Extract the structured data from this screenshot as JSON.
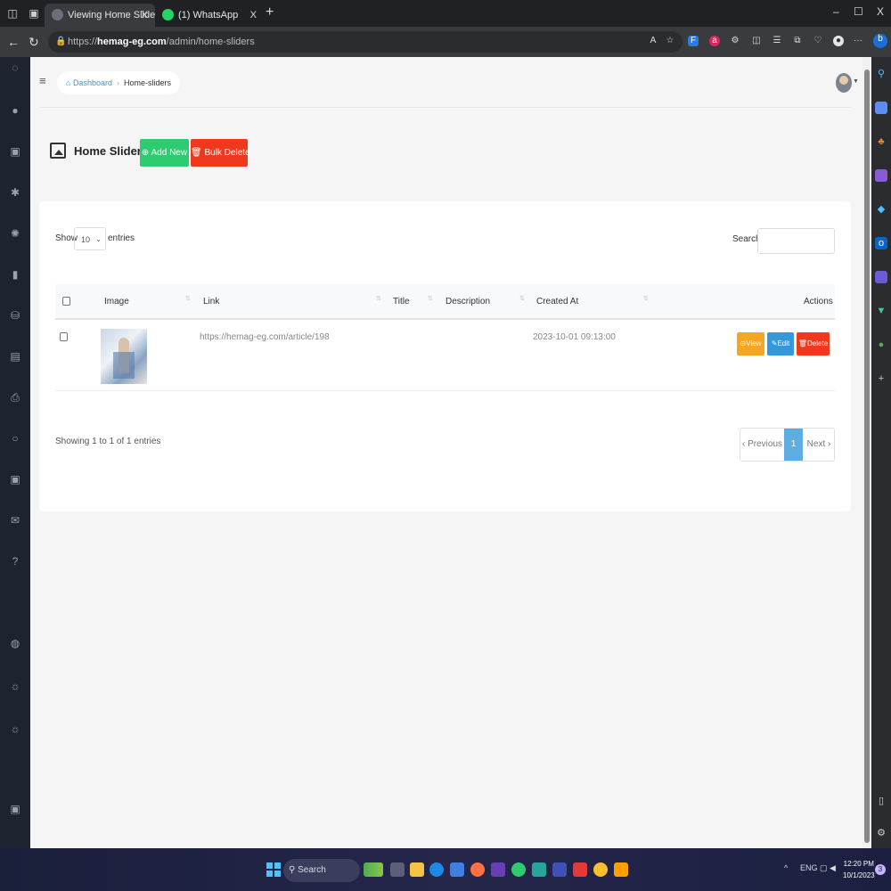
{
  "browser": {
    "tabs": [
      {
        "label": "Viewing Home Sliders",
        "close": "X"
      },
      {
        "label": "(1) WhatsApp",
        "close": "X"
      }
    ],
    "new_tab": "+",
    "window": {
      "minimize": "–",
      "restore": "☐",
      "close": "X"
    },
    "url_prefix": "https://",
    "url_host": "hemag-eg.com",
    "url_path": "/admin/home-sliders",
    "more": "···",
    "whatsapp_color": "#25d366"
  },
  "nav": {
    "breadcrumb": {
      "home": "Dashboard",
      "current": "Home-sliders"
    }
  },
  "page": {
    "title": "Home Sliders",
    "add_new": "Add New",
    "bulk_delete": "Bulk Delete"
  },
  "table": {
    "show_label": "Show",
    "length_value": "10",
    "entries_label": "entries",
    "search_label": "Search:",
    "columns": {
      "image": "Image",
      "link": "Link",
      "title": "Title",
      "description": "Description",
      "created_at": "Created At",
      "actions": "Actions"
    },
    "rows": [
      {
        "link": "https://hemag-eg.com/article/198",
        "title": "",
        "description": "",
        "created_at": "2023-10-01 09:13:00",
        "view": "View",
        "edit": "Edit",
        "delete": "Delete"
      }
    ],
    "info": "Showing 1 to 1 of 1 entries",
    "pagination": {
      "previous": "‹ Previous",
      "page": "1",
      "next": "Next ›"
    }
  },
  "taskbar": {
    "search": "Search",
    "tray_caret": "^",
    "language": "ENG",
    "time": "12:20 PM",
    "date": "10/1/2023",
    "notifications": "3"
  },
  "colors": {
    "success": "#2ecc71",
    "danger": "#f0391c",
    "warning": "#f5a623",
    "info": "#3498db",
    "sidebar": "#1e2330"
  }
}
